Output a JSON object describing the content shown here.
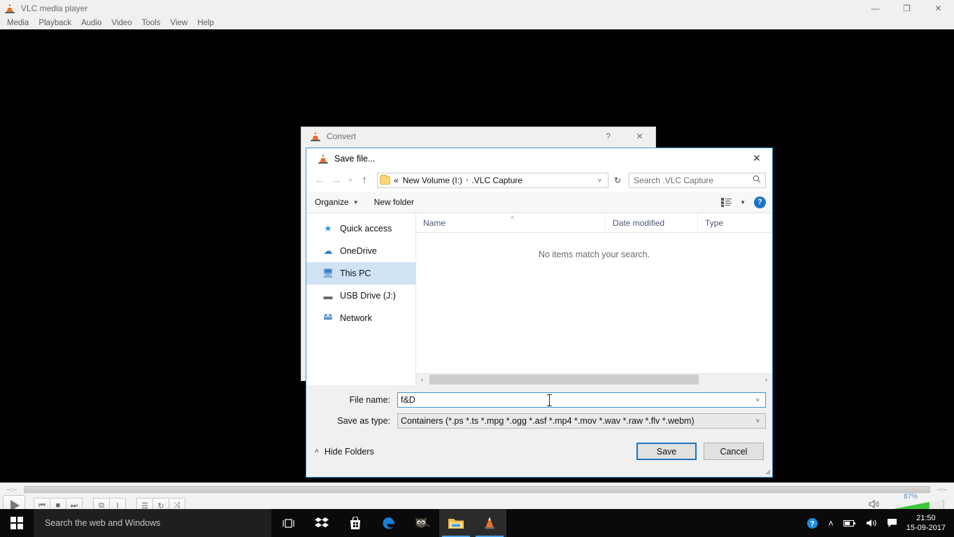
{
  "vlc": {
    "title": "VLC media player",
    "menu": [
      "Media",
      "Playback",
      "Audio",
      "Video",
      "Tools",
      "View",
      "Help"
    ],
    "window_controls": {
      "minimize": "—",
      "restore": "❐",
      "close": "✕"
    },
    "time_elapsed": "--:--",
    "time_total": "--:--",
    "controls": {
      "play": "play-button",
      "previous": "⏮",
      "stop": "■",
      "next": "⏭",
      "fullscreen": "⧉",
      "equalizer": "⌇",
      "playlist": "☰",
      "loop": "↻",
      "shuffle": "⤨"
    },
    "volume_percent": "87%",
    "volume_value": 87,
    "speaker_icon": "🔊"
  },
  "convert_dialog": {
    "title": "Convert",
    "help_btn": "?",
    "close_btn": "✕"
  },
  "save_dialog": {
    "title": "Save file...",
    "close_btn": "✕",
    "nav": {
      "back": "←",
      "forward": "→",
      "recent": "˅",
      "up": "↑",
      "breadcrumb_prefix": "«",
      "breadcrumb_drive": "New Volume (I:)",
      "breadcrumb_sep": "›",
      "breadcrumb_folder": ".VLC Capture",
      "dropdown": "˅",
      "refresh": "↻"
    },
    "search": {
      "placeholder": "Search .VLC Capture",
      "icon": "🔍"
    },
    "toolbar": {
      "organize": "Organize",
      "organize_caret": "▼",
      "new_folder": "New folder",
      "view_caret": "▼",
      "help": "?"
    },
    "sidebar": [
      {
        "label": "Quick access",
        "icon": "★",
        "color": "#3a9ad9",
        "selected": false
      },
      {
        "label": "OneDrive",
        "icon": "☁",
        "color": "#2f7fd0",
        "selected": false
      },
      {
        "label": "This PC",
        "icon": "🖥",
        "color": "#3a7fc4",
        "selected": true
      },
      {
        "label": "USB Drive (J:)",
        "icon": "▬",
        "color": "#6b6b6b",
        "selected": false
      },
      {
        "label": "Network",
        "icon": "🖴",
        "color": "#3a7fc4",
        "selected": false
      }
    ],
    "columns": [
      "Name",
      "Date modified",
      "Type"
    ],
    "sort_indicator": "˄",
    "empty_message": "No items match your search.",
    "scroll": {
      "left": "‹",
      "right": "›"
    },
    "file_name_label": "File name:",
    "file_name_value": "f&D",
    "save_type_label": "Save as type:",
    "save_type_value": "Containers (*.ps *.ts *.mpg *.ogg *.asf *.mp4 *.mov *.wav *.raw *.flv *.webm)",
    "dropdown_caret": "˅",
    "hide_folders": "Hide Folders",
    "hide_folders_chev": "˄",
    "save_button": "Save",
    "cancel_button": "Cancel"
  },
  "taskbar": {
    "search_placeholder": "Search the web and Windows",
    "icons": [
      {
        "name": "task-view",
        "glyph": "❑"
      },
      {
        "name": "dropbox",
        "glyph": "❖"
      },
      {
        "name": "microsoft-store",
        "glyph": "🛍"
      },
      {
        "name": "edge",
        "glyph": "e"
      },
      {
        "name": "gimp",
        "glyph": "🐺"
      },
      {
        "name": "file-explorer",
        "glyph": "📁"
      },
      {
        "name": "vlc",
        "glyph": "vlc-cone"
      }
    ],
    "tray": {
      "help": "?",
      "chevron": "˄",
      "battery": "▭",
      "volume": "🔊",
      "notifications": "💬"
    },
    "time": "21:50",
    "date": "15-09-2017"
  }
}
